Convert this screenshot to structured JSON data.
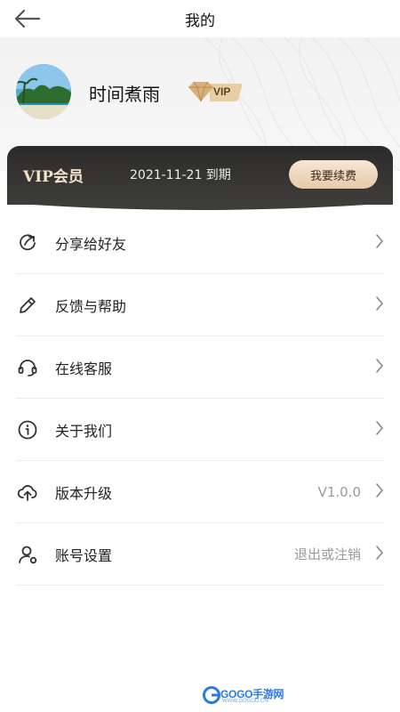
{
  "header": {
    "title": "我的"
  },
  "profile": {
    "username": "时间煮雨",
    "badge": "VIP"
  },
  "vip": {
    "title": "VIP会员",
    "expiry": "2021-11-21 到期",
    "renew_label": "我要续费"
  },
  "menu": [
    {
      "label": "分享给好友",
      "icon": "share-icon",
      "value": ""
    },
    {
      "label": "反馈与帮助",
      "icon": "pencil-icon",
      "value": ""
    },
    {
      "label": "在线客服",
      "icon": "headset-icon",
      "value": ""
    },
    {
      "label": "关于我们",
      "icon": "info-icon",
      "value": ""
    },
    {
      "label": "版本升级",
      "icon": "cloud-upload-icon",
      "value": "V1.0.0"
    },
    {
      "label": "账号设置",
      "icon": "user-settings-icon",
      "value": "退出或注销"
    }
  ],
  "watermark": {
    "brand": "GOGO手游网",
    "url": "WWW.GOGOD.CN"
  },
  "colors": {
    "vip_card": "#2c2b29",
    "vip_text": "#f3e2c8",
    "renew_button": "#f0d8bf"
  }
}
